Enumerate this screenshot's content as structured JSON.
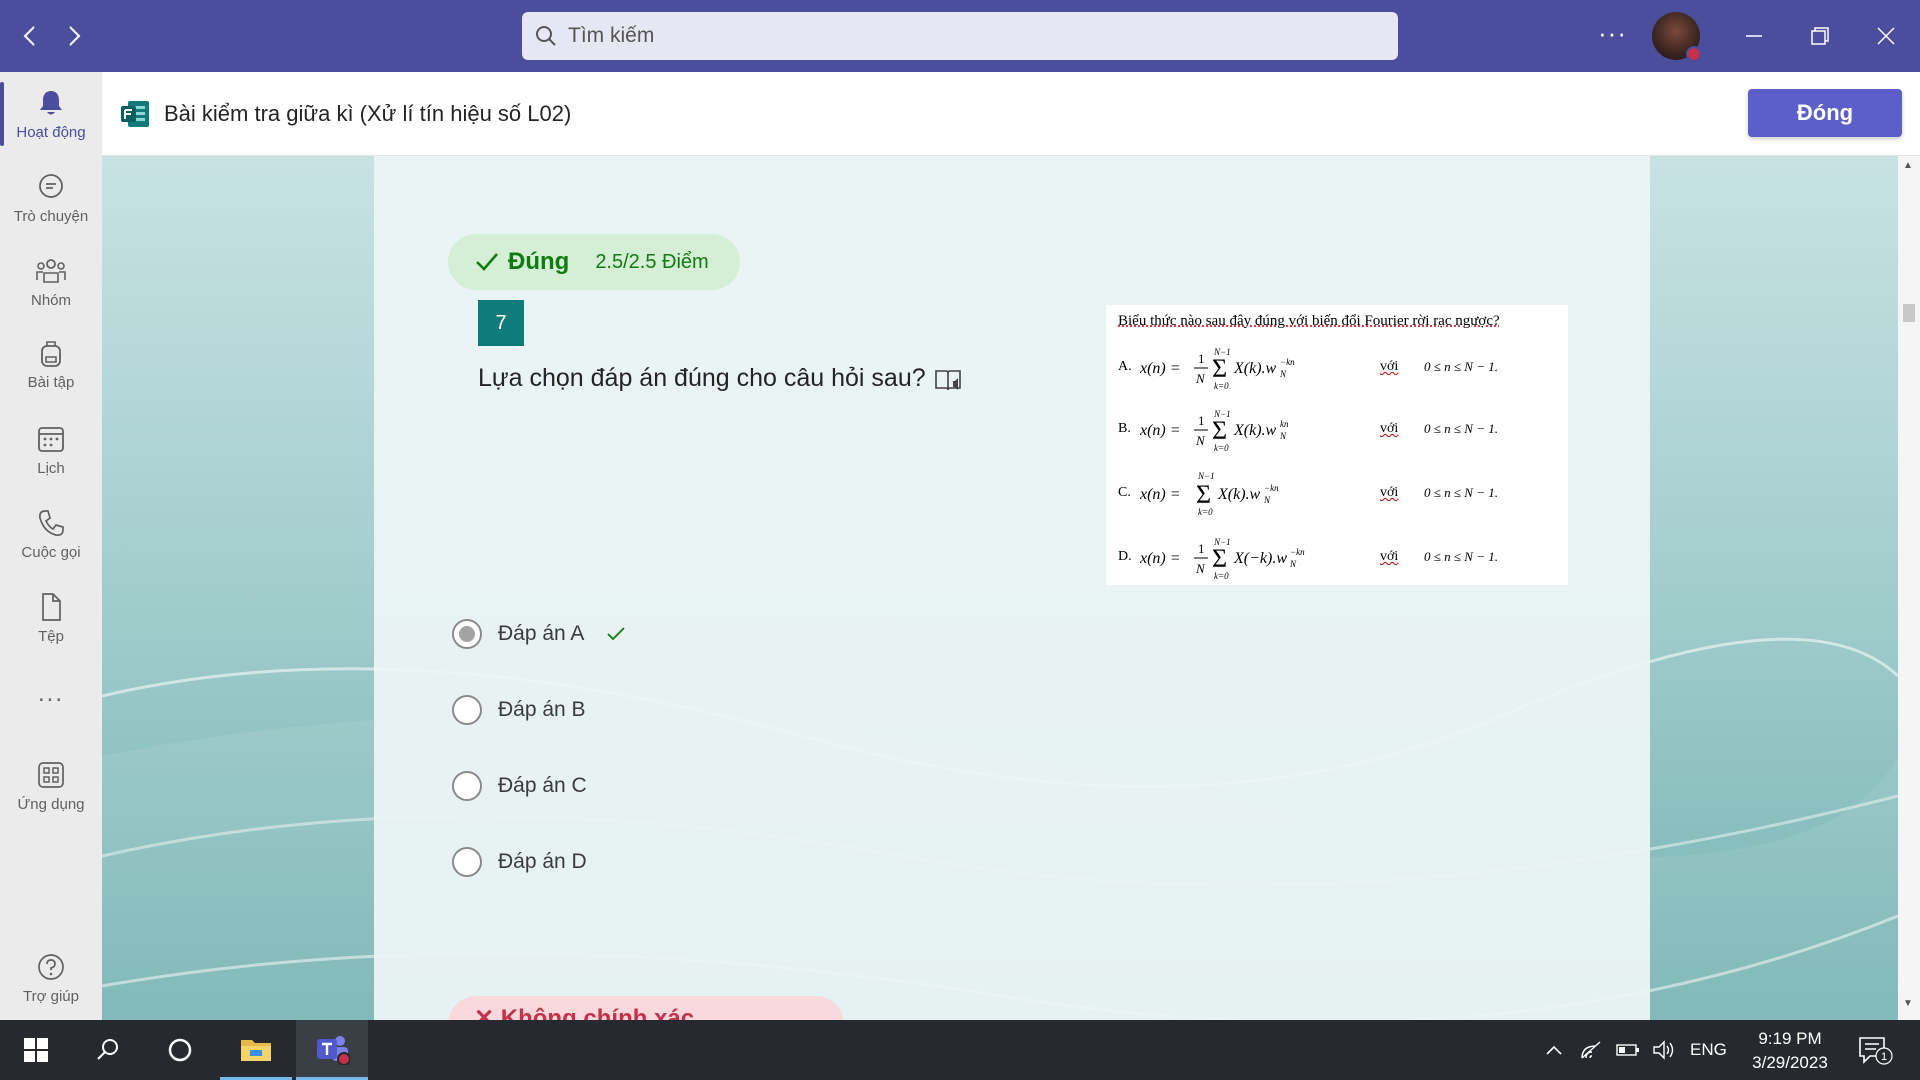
{
  "titlebar": {
    "search_placeholder": "Tìm kiếm",
    "more_label": "···",
    "accent": "#4a4e9c"
  },
  "rail": {
    "items": [
      {
        "label": "Hoạt động",
        "icon": "bell-icon",
        "active": true
      },
      {
        "label": "Trò chuyện",
        "icon": "chat-icon"
      },
      {
        "label": "Nhóm",
        "icon": "teams-icon"
      },
      {
        "label": "Bài tập",
        "icon": "backpack-icon"
      },
      {
        "label": "Lịch",
        "icon": "calendar-icon"
      },
      {
        "label": "Cuộc gọi",
        "icon": "phone-icon"
      },
      {
        "label": "Tệp",
        "icon": "file-icon"
      },
      {
        "label": "...",
        "icon": "more-icon"
      },
      {
        "label": "Ứng dụng",
        "icon": "apps-icon"
      },
      {
        "label": "Trợ giúp",
        "icon": "help-icon"
      }
    ]
  },
  "header": {
    "title": "Bài kiểm tra giữa kì (Xử lí tín hiệu số L02)",
    "close_label": "Đóng"
  },
  "question": {
    "result_status": "Đúng",
    "result_score": "2.5/2.5 Điểm",
    "number": "7",
    "text": "Lựa chọn đáp án đúng cho câu hỏi sau?",
    "image": {
      "stem": "Biểu thức nào sau đây đúng với biến đổi Fourier rời rạc ngược?",
      "options": [
        {
          "letter": "A.",
          "voi": "với",
          "cond": "0 ≤ n ≤ N − 1."
        },
        {
          "letter": "B.",
          "voi": "với",
          "cond": "0 ≤ n ≤ N − 1."
        },
        {
          "letter": "C.",
          "voi": "với",
          "cond": "0 ≤ n ≤ N − 1."
        },
        {
          "letter": "D.",
          "voi": "với",
          "cond": "0 ≤ n ≤ N − 1."
        }
      ]
    },
    "choices": [
      {
        "label": "Đáp án A",
        "selected": true,
        "correct": true
      },
      {
        "label": "Đáp án B",
        "selected": false
      },
      {
        "label": "Đáp án C",
        "selected": false
      },
      {
        "label": "Đáp án D",
        "selected": false
      }
    ],
    "next_result_status": "Không chính xác",
    "colors": {
      "correct": "#107c10",
      "incorrect": "#c4314b",
      "qnum_bg": "#0f7b7b"
    }
  },
  "taskbar": {
    "language": "ENG",
    "time": "9:19 PM",
    "date": "3/29/2023",
    "notification_count": "1"
  }
}
